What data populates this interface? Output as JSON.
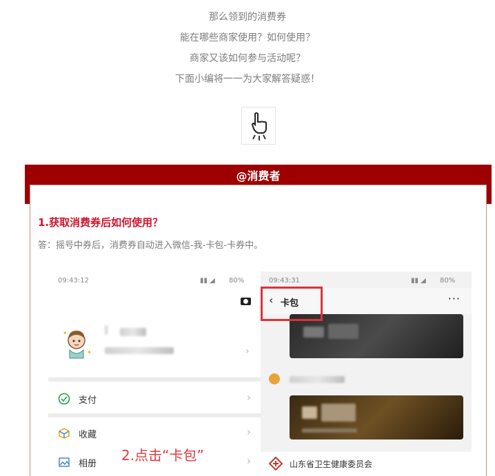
{
  "intro": {
    "line1": "那么领到的消费券",
    "line2": "能在哪些商家使用？如何使用？",
    "line3": "商家又该如何参与活动呢？",
    "line4": "下面小编将一一为大家解答疑惑！"
  },
  "section": {
    "title": "@消费者",
    "accent_color": "#9c0000"
  },
  "qa": {
    "question": "1.获取消费券后如何使用？",
    "answer": "答：摇号中券后，消费券自动进入微信-我-卡包-卡券中。",
    "question_color": "#d0142c"
  },
  "left_phone": {
    "time": "09:43:12",
    "battery": "80%",
    "menu": [
      {
        "label": "支付",
        "icon": "pay-check-icon"
      },
      {
        "label": "收藏",
        "icon": "favorites-cube-icon"
      },
      {
        "label": "相册",
        "icon": "album-image-icon"
      }
    ],
    "step_label": "2.点击“卡包”"
  },
  "right_phone": {
    "time": "09:43:31",
    "battery": "80%",
    "title": "卡包",
    "more": "···",
    "org_label": "山东省卫生健康委员会",
    "highlight_color": "#e0303a"
  }
}
